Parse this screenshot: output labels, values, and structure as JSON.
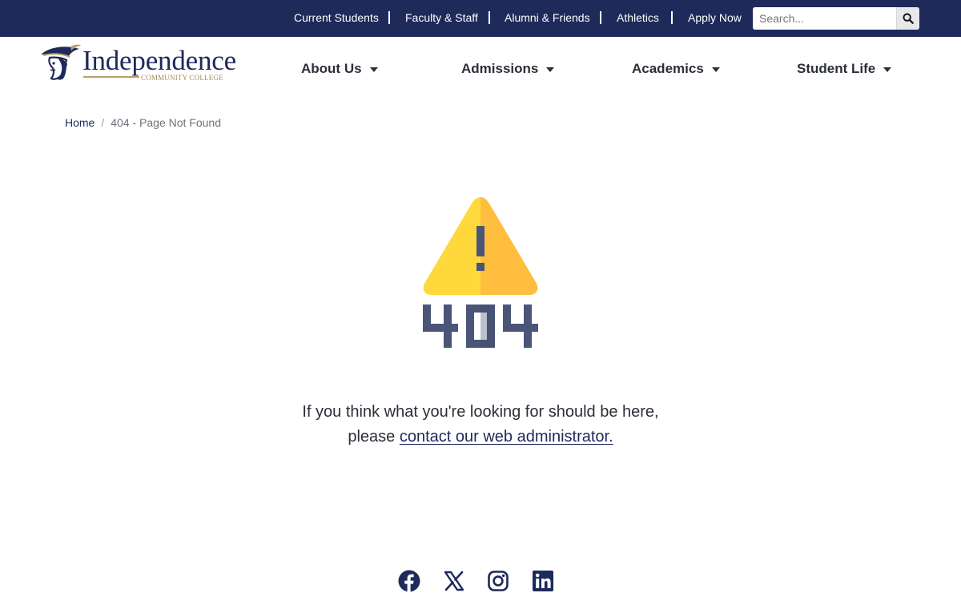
{
  "utility_nav": {
    "links": [
      {
        "label": "Current Students"
      },
      {
        "label": "Faculty & Staff"
      },
      {
        "label": "Alumni & Friends"
      },
      {
        "label": "Athletics"
      },
      {
        "label": "Apply Now"
      }
    ],
    "search": {
      "placeholder": "Search...",
      "value": "",
      "icon": "search-icon"
    }
  },
  "logo": {
    "name": "Independence",
    "subtitle": "COMMUNITY COLLEGE",
    "icon": "pirate-mascot-icon"
  },
  "main_nav": {
    "items": [
      {
        "label": "About Us",
        "icon": "caret-down-icon"
      },
      {
        "label": "Admissions",
        "icon": "caret-down-icon"
      },
      {
        "label": "Academics",
        "icon": "caret-down-icon"
      },
      {
        "label": "Student Life",
        "icon": "caret-down-icon"
      }
    ]
  },
  "breadcrumb": {
    "home": "Home",
    "separator": "/",
    "current": "404 - Page Not Found"
  },
  "error_graphic": {
    "icon": "warning-triangle-icon",
    "code": "404"
  },
  "message": {
    "line1": "If you think what you're looking for should be here,",
    "line2_prefix": "please",
    "link_label": "contact our web administrator."
  },
  "social": {
    "icons": [
      "facebook-icon",
      "x-twitter-icon",
      "instagram-icon",
      "linkedin-icon"
    ]
  },
  "colors": {
    "navy": "#1e2a5a",
    "gold": "#b9a06a",
    "warning_light": "#ffd93b",
    "warning_dark": "#ffbe3d",
    "code_slate": "#4a5578"
  }
}
